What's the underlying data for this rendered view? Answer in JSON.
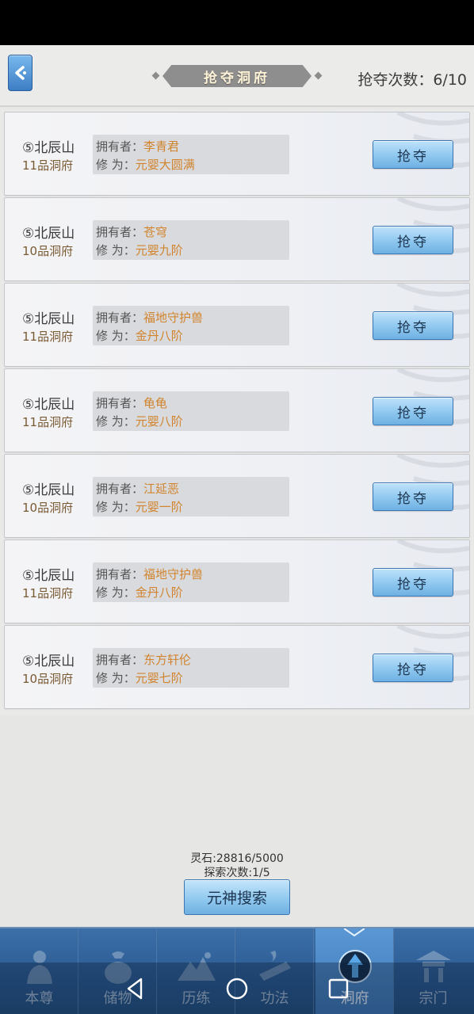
{
  "header": {
    "title": "抢夺洞府",
    "raid_count_label": "抢夺次数：6/10"
  },
  "labels": {
    "owner": "拥有者：",
    "cultivation": "修 为："
  },
  "caves": [
    {
      "name": "⑤北辰山",
      "grade": "11品洞府",
      "owner": "李青君",
      "cultivation": "元婴大圆满",
      "button": "抢夺"
    },
    {
      "name": "⑤北辰山",
      "grade": "10品洞府",
      "owner": "苍穹",
      "cultivation": "元婴九阶",
      "button": "抢夺"
    },
    {
      "name": "⑤北辰山",
      "grade": "11品洞府",
      "owner": "福地守护兽",
      "cultivation": "金丹八阶",
      "button": "抢夺"
    },
    {
      "name": "⑤北辰山",
      "grade": "11品洞府",
      "owner": "龟龟",
      "cultivation": "元婴八阶",
      "button": "抢夺"
    },
    {
      "name": "⑤北辰山",
      "grade": "10品洞府",
      "owner": "江延恶",
      "cultivation": "元婴一阶",
      "button": "抢夺"
    },
    {
      "name": "⑤北辰山",
      "grade": "11品洞府",
      "owner": "福地守护兽",
      "cultivation": "金丹八阶",
      "button": "抢夺"
    },
    {
      "name": "⑤北辰山",
      "grade": "10品洞府",
      "owner": "东方轩伦",
      "cultivation": "元婴七阶",
      "button": "抢夺"
    }
  ],
  "resources": {
    "spirit_stones": "灵石:28816/5000",
    "explore_count": "探索次数:1/5",
    "search_button": "元神搜索"
  },
  "nav": {
    "items": [
      {
        "label": "本尊",
        "icon": "person-icon"
      },
      {
        "label": "储物",
        "icon": "bag-icon"
      },
      {
        "label": "历练",
        "icon": "mountain-icon"
      },
      {
        "label": "功法",
        "icon": "scroll-icon"
      },
      {
        "label": "洞府",
        "icon": "cave-icon"
      },
      {
        "label": "宗门",
        "icon": "pavilion-icon"
      }
    ],
    "active": "洞府"
  },
  "colors": {
    "accent_blue": "#6fb1e2",
    "value_orange": "#d1842d",
    "nav_bg": "#2b5a92"
  }
}
